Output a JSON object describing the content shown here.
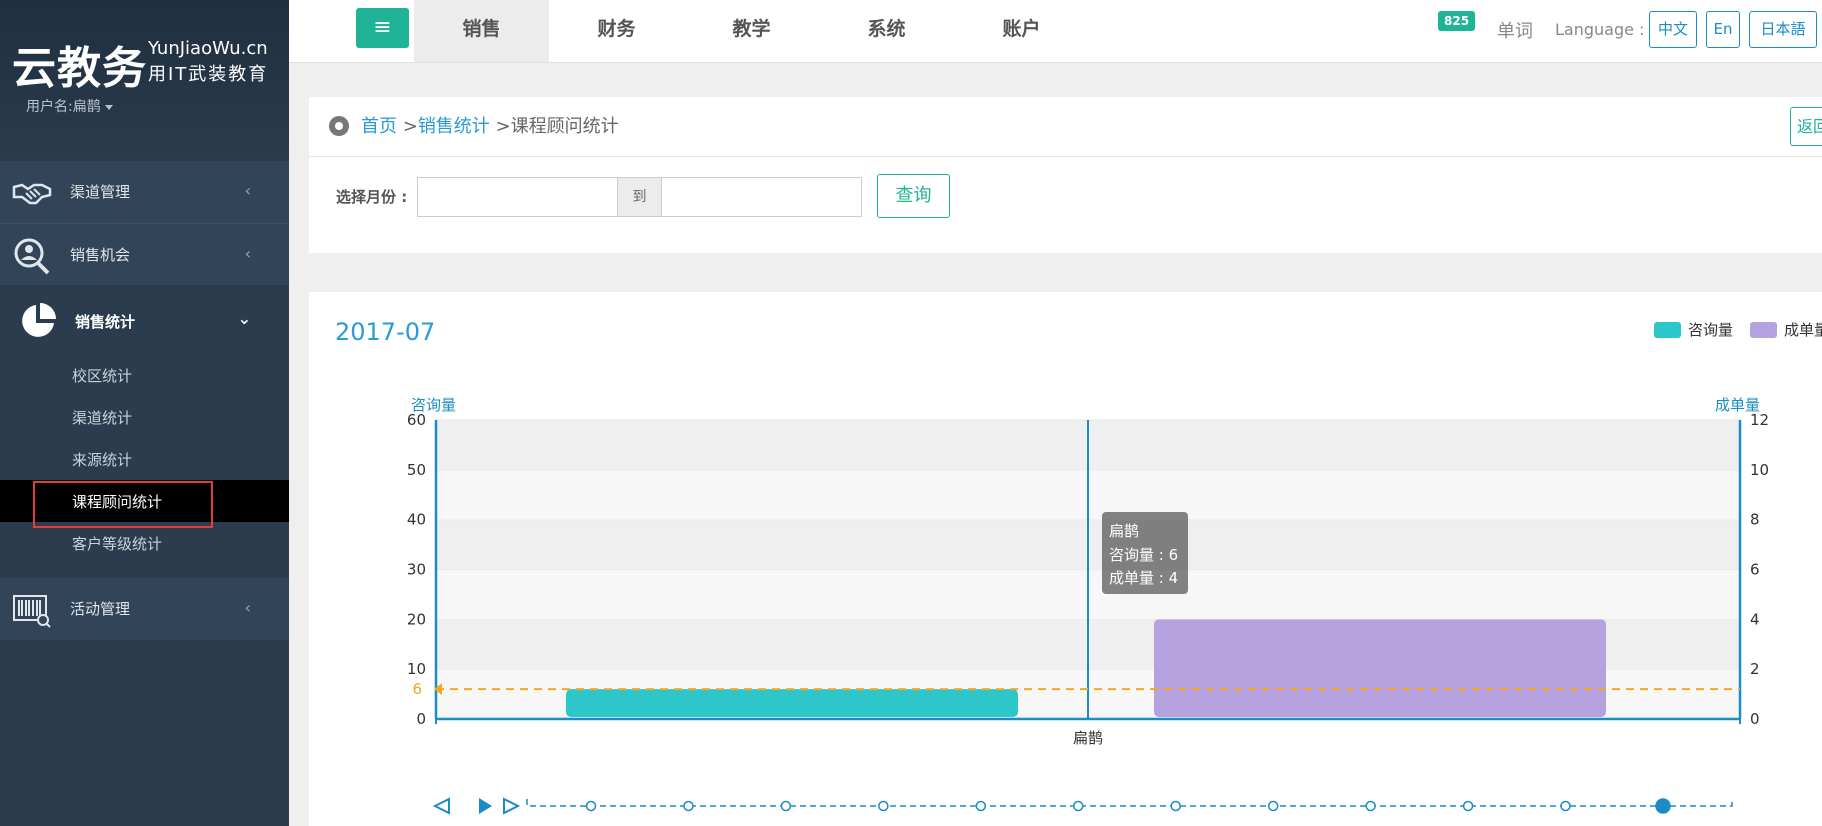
{
  "sidebar": {
    "brand_cn": "云教务",
    "brand_en": "YunJiaoWu.cn",
    "brand_slogan": "用IT武装教育",
    "username": "用户名:扁鹊",
    "menu": [
      {
        "label": "渠道管理",
        "icon": "handshake-icon"
      },
      {
        "label": "销售机会",
        "icon": "search-user-icon"
      },
      {
        "label": "销售统计",
        "icon": "pie-chart-icon"
      },
      {
        "label": "活动管理",
        "icon": "barcode-scan-icon"
      }
    ],
    "sub_items": [
      "校区统计",
      "渠道统计",
      "来源统计",
      "课程顾问统计",
      "客户等级统计"
    ]
  },
  "topnav": {
    "menu_toggle": "≡",
    "tabs": [
      "销售",
      "财务",
      "教学",
      "系统",
      "账户"
    ],
    "message_count": "825",
    "words_label": "单词",
    "language_label": "Language :",
    "languages": [
      "中文",
      "En",
      "日本語"
    ]
  },
  "breadcrumb": {
    "home": "首页",
    "sep1": " >",
    "sales_stats": "销售统计",
    "sep2": " >",
    "current": "课程顾问统计"
  },
  "return_button": "返回",
  "filter": {
    "month_label": "选择月份 :",
    "start_value": "",
    "to_label": "到",
    "end_value": "",
    "query_button": "查询"
  },
  "colors": {
    "accent_green": "#1fb497",
    "accent_blue": "#2a9bd4",
    "consult_bar": "#2ec7c9",
    "deal_bar": "#b6a2de",
    "markline": "#f5a623"
  },
  "chart_data": {
    "type": "bar",
    "title": "2017-07",
    "categories": [
      "扁鹊"
    ],
    "series": [
      {
        "name": "咨询量",
        "values": [
          6
        ],
        "axis": "left"
      },
      {
        "name": "成单量",
        "values": [
          4
        ],
        "axis": "right"
      }
    ],
    "y_left": {
      "label": "咨询量",
      "range": [
        0,
        60
      ],
      "ticks": [
        0,
        10,
        20,
        30,
        40,
        50,
        60
      ]
    },
    "y_right": {
      "label": "成单量",
      "range": [
        0,
        12
      ],
      "ticks": [
        0,
        2,
        4,
        6,
        8,
        10,
        12
      ]
    },
    "markline": {
      "value": 6,
      "label": "6"
    },
    "legend_position": "top-right",
    "grid": true,
    "tooltip": {
      "title": "扁鹊",
      "lines": [
        "咨询量 : 6",
        "成单量 : 4"
      ]
    },
    "timeline": {
      "points": 12,
      "current_index": 11
    }
  }
}
